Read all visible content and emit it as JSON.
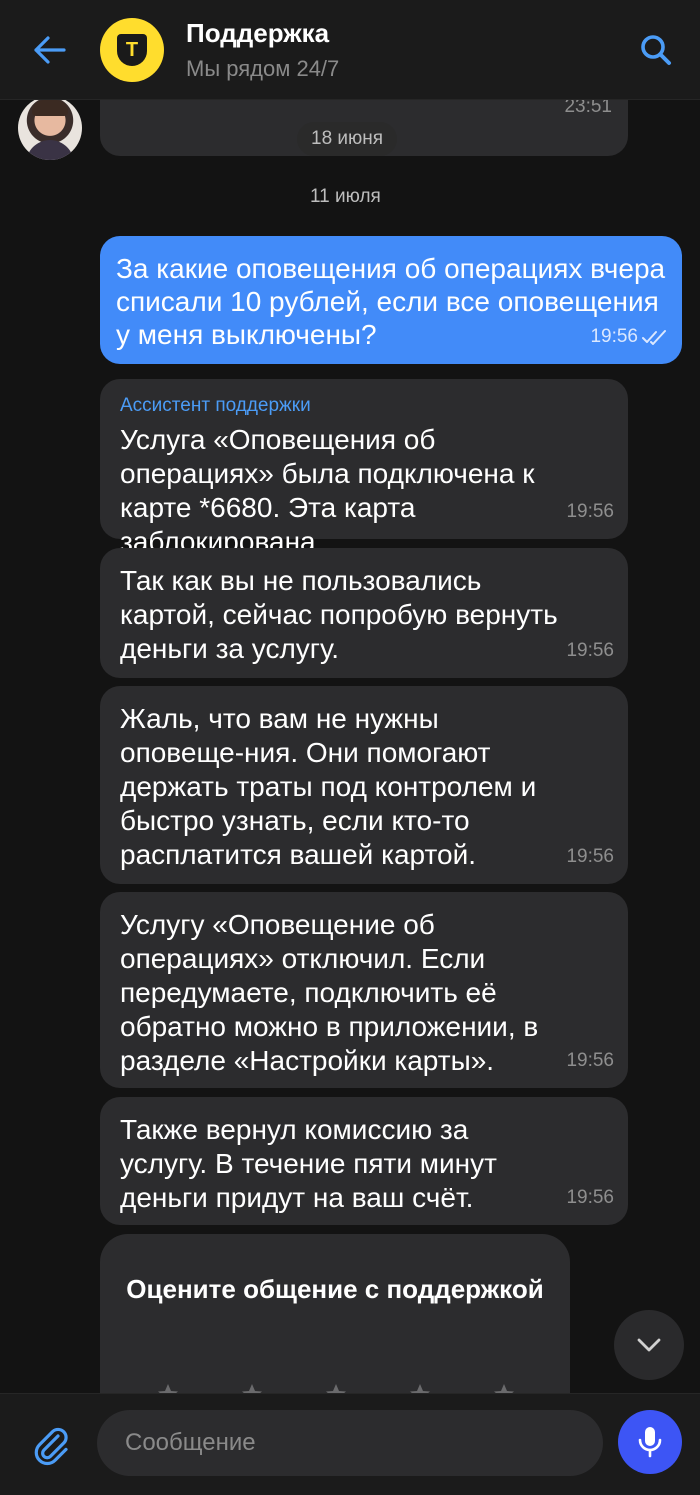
{
  "header": {
    "title": "Поддержка",
    "subtitle": "Мы рядом 24/7",
    "avatar_letter": "Т",
    "brand_color": "#ffdd2d",
    "accent_color": "#428bf9",
    "icons": {
      "back": "arrow-left-icon",
      "search": "search-icon"
    }
  },
  "chat": {
    "previous_message_time": "23:51",
    "date_separators": [
      "18 июня",
      "11 июля"
    ],
    "outgoing": {
      "text": "За какие оповещения об операциях вчера списали 10 рублей, если все оповещения у меня выключены?",
      "time": "19:56",
      "status_icon": "double-check-icon"
    },
    "incoming": [
      {
        "sender": "Ассистент поддержки",
        "text": "Услуга «Оповещения об операциях» была подключена к карте *6680. Эта карта заблокирована.",
        "time": "19:56"
      },
      {
        "text": "Так как вы не пользовались картой, сейчас попробую вернуть деньги за услугу.",
        "time": "19:56"
      },
      {
        "text": "Жаль, что вам не нужны оповеще-ния. Они помогают держать траты под контролем и быстро узнать, если кто-то расплатится вашей картой.",
        "time": "19:56"
      },
      {
        "text": "Услугу «Оповещение об операциях» отключил. Если передумаете, подключить её обратно можно в приложении, в разделе «Настройки карты».",
        "time": "19:56"
      },
      {
        "text": "Также вернул комиссию за услугу. В течение пяти минут деньги придут на ваш счёт.",
        "time": "19:56"
      }
    ],
    "rating": {
      "title": "Оцените общение с поддержкой",
      "stars": 5
    }
  },
  "composer": {
    "placeholder": "Сообщение",
    "icons": {
      "attach": "paperclip-icon",
      "mic": "microphone-icon",
      "scroll": "chevron-down-icon"
    },
    "mic_color": "#3d55f5"
  }
}
